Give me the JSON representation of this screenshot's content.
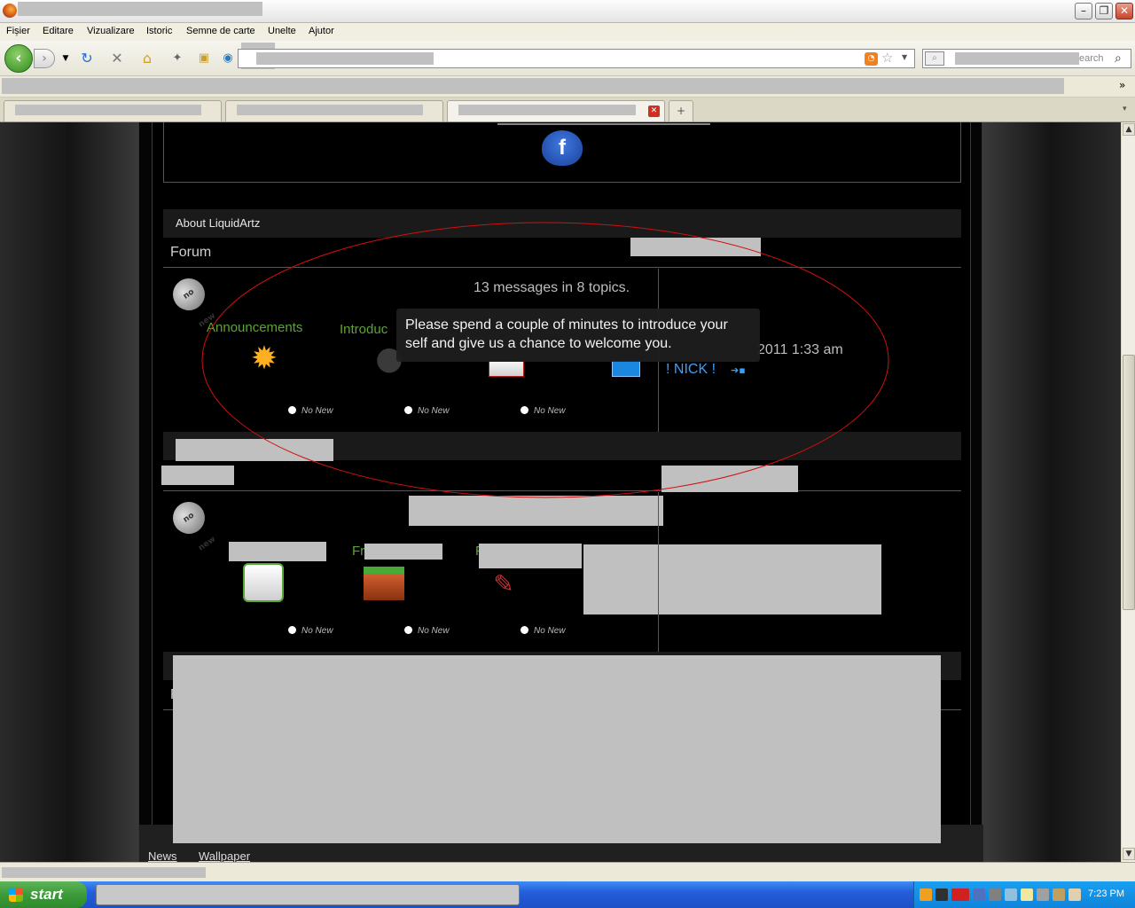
{
  "browser": {
    "menu": [
      "Fișier",
      "Editare",
      "Vizualizare",
      "Istoric",
      "Semne de carte",
      "Unelte",
      "Ajutor"
    ],
    "search_placeholder": "earch",
    "tab_add": "+"
  },
  "page": {
    "category_title": "About LiquidArtz",
    "forum_col_label": "Forum",
    "stats": "13 messages in 8 topics.",
    "subforums": [
      "Announcements",
      "Introduc"
    ],
    "no_new_label": "No New",
    "last_post_time": "2011 1:33 am",
    "last_post_user": "! NICK !",
    "tooltip": "Please spend a couple of minutes to introduce your self and give us a chance to welcome you.",
    "row2_sub_fragments": [
      "Fr",
      "F"
    ],
    "footer_links": [
      "News",
      "Wallpaper"
    ],
    "section3_letter": "F"
  },
  "taskbar": {
    "start_label": "start",
    "clock": "7:23 PM"
  },
  "colors": {
    "accent_green": "#5aa632",
    "link_blue": "#3aa0ff",
    "ellipse_red": "#d01010"
  }
}
